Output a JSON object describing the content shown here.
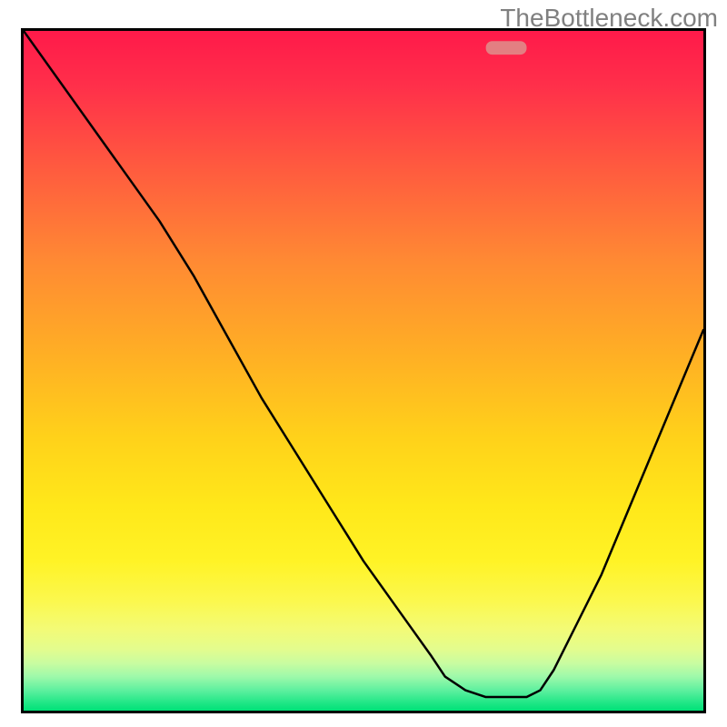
{
  "watermark": "TheBottleneck.com",
  "frame": {
    "border_color": "#000000",
    "border_width_px": 3
  },
  "gradient_stops": [
    {
      "pct": 0,
      "color": "#ff1a4a"
    },
    {
      "pct": 8,
      "color": "#ff2f4a"
    },
    {
      "pct": 20,
      "color": "#ff5a3f"
    },
    {
      "pct": 34,
      "color": "#ff8a33"
    },
    {
      "pct": 48,
      "color": "#ffb024"
    },
    {
      "pct": 60,
      "color": "#ffd21a"
    },
    {
      "pct": 70,
      "color": "#ffe81a"
    },
    {
      "pct": 78,
      "color": "#fff326"
    },
    {
      "pct": 84,
      "color": "#fbf84f"
    },
    {
      "pct": 88,
      "color": "#f3fb76"
    },
    {
      "pct": 91,
      "color": "#e3fc8e"
    },
    {
      "pct": 93,
      "color": "#c9fca0"
    },
    {
      "pct": 95,
      "color": "#9ef9aa"
    },
    {
      "pct": 97,
      "color": "#5ef09f"
    },
    {
      "pct": 99,
      "color": "#1be684"
    },
    {
      "pct": 100,
      "color": "#00e178"
    }
  ],
  "marker": {
    "x_pct": 71.0,
    "y_pct": 97.5,
    "width_pct": 6.0,
    "height_pct": 2.0,
    "color": "#e37f82"
  },
  "chart_data": {
    "type": "line",
    "title": "",
    "xlabel": "",
    "ylabel": "",
    "xlim": [
      0,
      100
    ],
    "ylim": [
      0,
      100
    ],
    "grid": false,
    "legend": false,
    "x": [
      0,
      5,
      10,
      15,
      20,
      25,
      30,
      35,
      40,
      45,
      50,
      55,
      60,
      62,
      65,
      68,
      70,
      72,
      74,
      76,
      78,
      80,
      85,
      90,
      95,
      100
    ],
    "y": [
      100,
      93,
      86,
      79,
      72,
      64,
      55,
      46,
      38,
      30,
      22,
      15,
      8,
      5,
      3,
      2,
      2,
      2,
      2,
      3,
      6,
      10,
      20,
      32,
      44,
      56
    ],
    "annotations": [
      {
        "type": "flat_minimum_marker",
        "x_range": [
          68,
          74
        ],
        "y": 2.5,
        "color": "#e37f82"
      }
    ]
  }
}
